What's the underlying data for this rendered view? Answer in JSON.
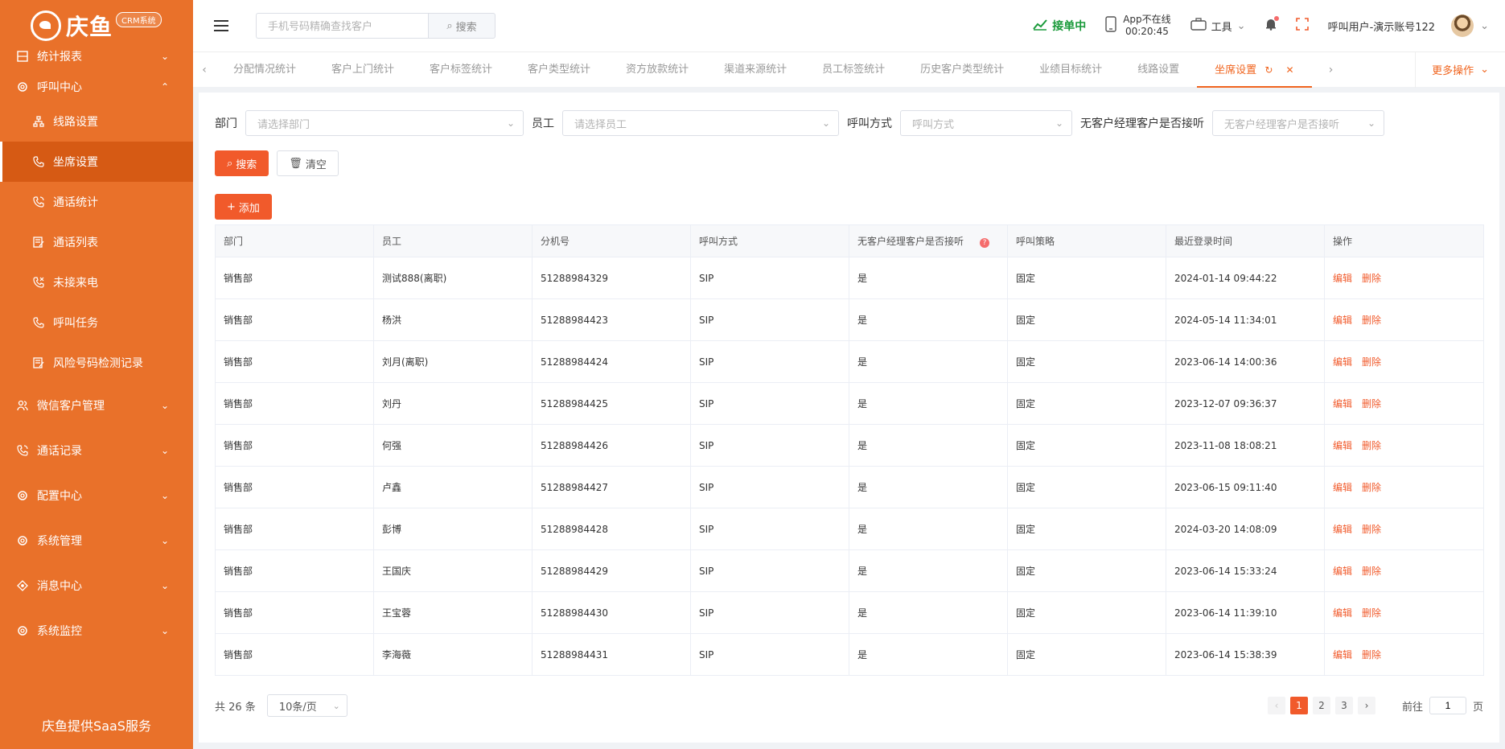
{
  "brand": {
    "logo_text": "庆鱼",
    "badge": "CRM系统",
    "footer": "庆鱼提供SaaS服务"
  },
  "sidebar": {
    "groups_top": [
      {
        "label": "统计报表",
        "icon": "chart-icon",
        "expanded": false
      }
    ],
    "call_center": {
      "label": "呼叫中心",
      "icon": "gear-icon",
      "expanded": true,
      "items": [
        {
          "label": "线路设置",
          "icon": "network-icon"
        },
        {
          "label": "坐席设置",
          "icon": "phone-icon",
          "active": true
        },
        {
          "label": "通话统计",
          "icon": "phone-call-icon"
        },
        {
          "label": "通话列表",
          "icon": "list-edit-icon"
        },
        {
          "label": "未接来电",
          "icon": "phone-missed-icon"
        },
        {
          "label": "呼叫任务",
          "icon": "phone-icon"
        },
        {
          "label": "风险号码检测记录",
          "icon": "list-edit-icon"
        }
      ]
    },
    "groups_bottom": [
      {
        "label": "微信客户管理",
        "icon": "users-icon"
      },
      {
        "label": "通话记录",
        "icon": "phone-call-icon"
      },
      {
        "label": "配置中心",
        "icon": "gear-icon"
      },
      {
        "label": "系统管理",
        "icon": "gear-icon"
      },
      {
        "label": "消息中心",
        "icon": "message-icon"
      },
      {
        "label": "系统监控",
        "icon": "gear-icon"
      }
    ]
  },
  "header": {
    "search_placeholder": "手机号码精确查找客户",
    "search_button": "搜索",
    "status": "接单中",
    "app_status_line1": "App不在线",
    "app_status_line2": "00:20:45",
    "tools": "工具",
    "user": "呼叫用户-演示账号122"
  },
  "tabs": {
    "items": [
      "分配情况统计",
      "客户上门统计",
      "客户标签统计",
      "客户类型统计",
      "资方放款统计",
      "渠道来源统计",
      "员工标签统计",
      "历史客户类型统计",
      "业绩目标统计",
      "线路设置"
    ],
    "active": "坐席设置",
    "more": "更多操作"
  },
  "filters": {
    "dept_label": "部门",
    "dept_placeholder": "请选择部门",
    "emp_label": "员工",
    "emp_placeholder": "请选择员工",
    "method_label": "呼叫方式",
    "method_placeholder": "呼叫方式",
    "nomgr_label": "无客户经理客户是否接听",
    "nomgr_placeholder": "无客户经理客户是否接听",
    "search_btn": "搜索",
    "clear_btn": "清空",
    "add_btn": "添加"
  },
  "table": {
    "columns": [
      "部门",
      "员工",
      "分机号",
      "呼叫方式",
      "无客户经理客户是否接听",
      "呼叫策略",
      "最近登录时间",
      "操作"
    ],
    "edit_label": "编辑",
    "delete_label": "删除",
    "rows": [
      [
        "销售部",
        "测试888(离职)",
        "51288984329",
        "SIP",
        "是",
        "固定",
        "2024-01-14 09:44:22"
      ],
      [
        "销售部",
        "杨洪",
        "51288984423",
        "SIP",
        "是",
        "固定",
        "2024-05-14 11:34:01"
      ],
      [
        "销售部",
        "刘月(离职)",
        "51288984424",
        "SIP",
        "是",
        "固定",
        "2023-06-14 14:00:36"
      ],
      [
        "销售部",
        "刘丹",
        "51288984425",
        "SIP",
        "是",
        "固定",
        "2023-12-07 09:36:37"
      ],
      [
        "销售部",
        "何强",
        "51288984426",
        "SIP",
        "是",
        "固定",
        "2023-11-08 18:08:21"
      ],
      [
        "销售部",
        "卢鑫",
        "51288984427",
        "SIP",
        "是",
        "固定",
        "2023-06-15 09:11:40"
      ],
      [
        "销售部",
        "彭博",
        "51288984428",
        "SIP",
        "是",
        "固定",
        "2024-03-20 14:08:09"
      ],
      [
        "销售部",
        "王国庆",
        "51288984429",
        "SIP",
        "是",
        "固定",
        "2023-06-14 15:33:24"
      ],
      [
        "销售部",
        "王宝蓉",
        "51288984430",
        "SIP",
        "是",
        "固定",
        "2023-06-14 11:39:10"
      ],
      [
        "销售部",
        "李海薇",
        "51288984431",
        "SIP",
        "是",
        "固定",
        "2023-06-14 15:38:39"
      ]
    ]
  },
  "pager": {
    "total": "共 26 条",
    "page_size": "10条/页",
    "pages": [
      "1",
      "2",
      "3"
    ],
    "current": "1",
    "goto_label": "前往",
    "goto_value": "1",
    "goto_suffix": "页"
  },
  "colors": {
    "sidebar": "#e9712a",
    "accent": "#f15a2b",
    "status_ok": "#1a9a3a"
  }
}
